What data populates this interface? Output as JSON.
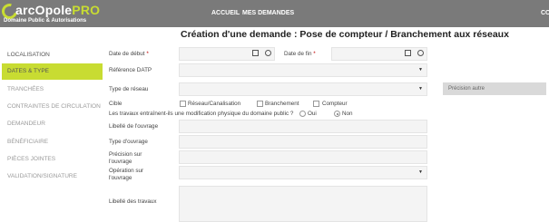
{
  "header": {
    "logo_main": "arcOpole",
    "logo_pro": "PRO",
    "logo_sub": "Domaine Public & Autorisations",
    "nav": [
      "ACCUEIL",
      "MES DEMANDES",
      "CO"
    ]
  },
  "page": {
    "title": "Création d'une demande : Pose de compteur / Branchement aux réseaux"
  },
  "sidebar": {
    "items": [
      {
        "label": "LOCALISATION"
      },
      {
        "label": "DATES & TYPE"
      },
      {
        "label": "TRANCHÉES"
      },
      {
        "label": "CONTRAINTES DE CIRCULATION"
      },
      {
        "label": "DEMANDEUR"
      },
      {
        "label": "BÉNÉFICIAIRE"
      },
      {
        "label": "PIÈCES JOINTES"
      },
      {
        "label": "VALIDATION/SIGNATURE"
      }
    ],
    "active_index": 1
  },
  "form": {
    "date_debut_label": "Date de début",
    "date_fin_label": "Date de fin",
    "required_mark": "*",
    "reference_datp_label": "Référence DATP",
    "type_reseau_label": "Type de réseau",
    "precision_autre_placeholder": "Précision autre",
    "cible_label": "Cible",
    "cible_options": [
      "Réseau/Canalisation",
      "Branchement",
      "Compteur"
    ],
    "modif_question": "Les travaux entraînent-ils une modification physique du domaine public ?",
    "radio_oui": "Oui",
    "radio_non": "Non",
    "radio_selected": "Non",
    "libelle_ouvrage_label": "Libellé de l'ouvrage",
    "type_ouvrage_label": "Type d'ouvrage",
    "precision_ouvrage_label_1": "Précision sur",
    "precision_ouvrage_label_2": "l'ouvrage",
    "operation_ouvrage_label_1": "Opération sur",
    "operation_ouvrage_label_2": "l'ouvrage",
    "libelle_travaux_label": "Libellé des travaux"
  },
  "colors": {
    "header_bg": "#7a7a7a",
    "accent": "#c8dc32",
    "required": "#c00000"
  }
}
